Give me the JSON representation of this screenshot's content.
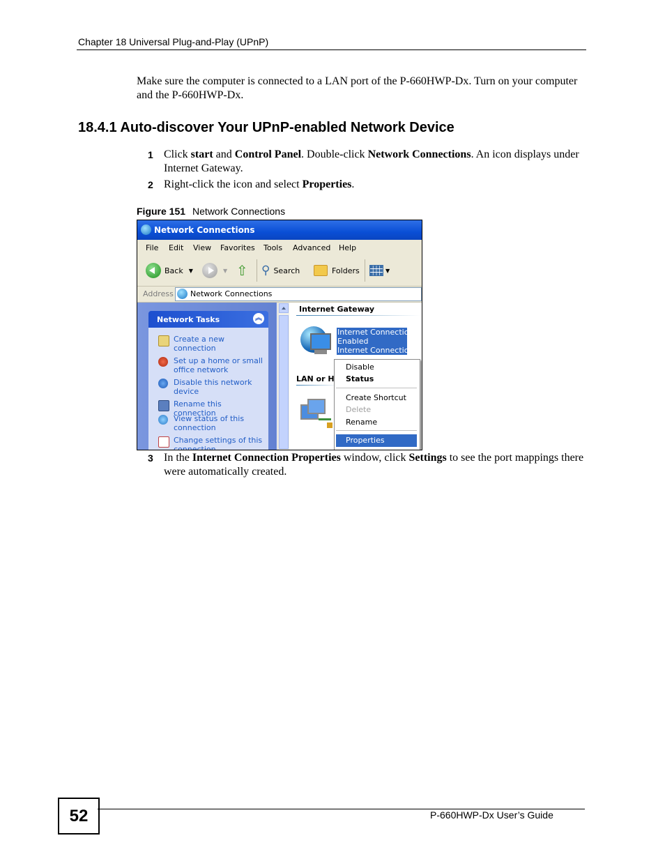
{
  "header": {
    "chapter": "Chapter 18 Universal Plug-and-Play (UPnP)"
  },
  "intro": "Make sure the computer is connected to a LAN port of the P-660HWP-Dx. Turn on your computer and the P-660HWP-Dx.",
  "section": {
    "title": "18.4.1  Auto-discover Your UPnP-enabled Network Device"
  },
  "steps": [
    {
      "num": "1",
      "t1": "Click ",
      "b1": "start",
      "t2": " and ",
      "b2": "Control Panel",
      "t3": ". Double-click ",
      "b3": "Network Connections",
      "t4": ". An icon displays under Internet Gateway."
    },
    {
      "num": "2",
      "t1": "Right-click the icon and select ",
      "b1": "Properties",
      "t2": "."
    },
    {
      "num": "3",
      "t1": "In the ",
      "b1": "Internet Connection Properties",
      "t2": " window, click ",
      "b2": "Settings",
      "t3": " to see the port mappings there were automatically created."
    }
  ],
  "figure": {
    "label": "Figure 151",
    "caption": "Network Connections"
  },
  "window": {
    "title": "Network Connections",
    "menu": [
      "File",
      "Edit",
      "View",
      "Favorites",
      "Tools",
      "Advanced",
      "Help"
    ],
    "toolbar": {
      "back": "Back",
      "search": "Search",
      "folders": "Folders"
    },
    "address": {
      "label": "Address",
      "value": "Network Connections"
    },
    "tasks": {
      "title": "Network Tasks",
      "items": [
        {
          "l1": "Create a new",
          "l2": "connection"
        },
        {
          "l1": "Set up a home or small",
          "l2": "office network"
        },
        {
          "l1": "Disable this network",
          "l2": "device"
        },
        {
          "l1": "Rename this connection",
          "l2": ""
        },
        {
          "l1": "View status of this",
          "l2": "connection"
        },
        {
          "l1": "Change settings of this",
          "l2": "connection"
        }
      ]
    },
    "groups": {
      "gateway": "Internet Gateway",
      "lan": "LAN or H"
    },
    "selected_icon": {
      "line1": "Internet Connection",
      "line2": "Enabled",
      "line3": "Internet Connection"
    },
    "context_menu": {
      "disable": "Disable",
      "status": "Status",
      "shortcut": "Create Shortcut",
      "delete": "Delete",
      "rename": "Rename",
      "properties": "Properties"
    },
    "colors": {
      "titlebar": "#0a4fd6",
      "selection": "#316ac5",
      "task_link": "#215dc6"
    }
  },
  "footer": {
    "page": "52",
    "guide": "P-660HWP-Dx User’s Guide"
  }
}
